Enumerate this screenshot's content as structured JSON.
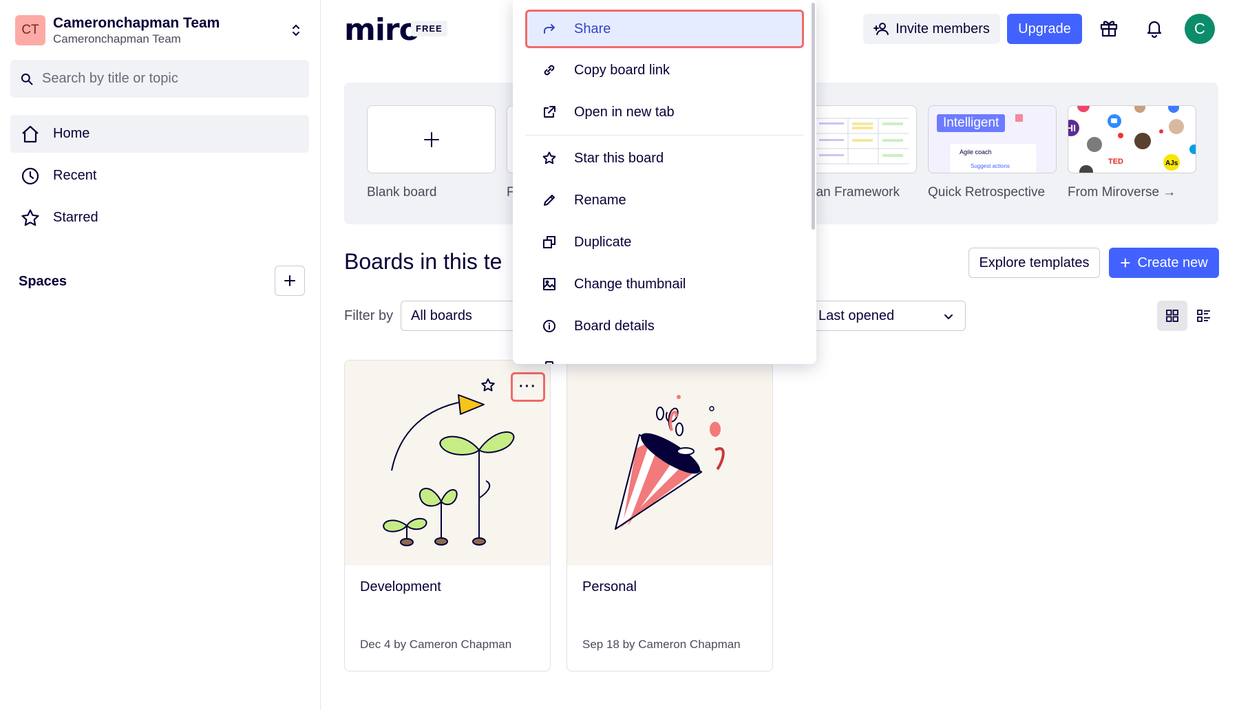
{
  "team": {
    "initials": "CT",
    "name": "Cameronchapman Team",
    "subtitle": "Cameronchapman Team"
  },
  "search": {
    "placeholder": "Search by title or topic"
  },
  "nav": {
    "home": "Home",
    "recent": "Recent",
    "starred": "Starred"
  },
  "spaces": {
    "label": "Spaces"
  },
  "header": {
    "logo": "miro",
    "plan": "FREE",
    "invite": "Invite members",
    "upgrade": "Upgrade",
    "avatar_initial": "C"
  },
  "templates": {
    "blank": "Blank board",
    "partial_left": "F",
    "partial_kanban": "oan Framework",
    "quick_retro": "Quick Retrospective",
    "miroverse": "From Miroverse →",
    "retro_tag": "Intelligent",
    "retro_coach": "Agile coach",
    "retro_actions": "Suggest actions",
    "ted": "TED",
    "ajs": "AJs",
    "hi": "HI"
  },
  "boards_section": {
    "title": "Boards in this te",
    "explore": "Explore templates",
    "create": "Create new",
    "filter_label": "Filter by",
    "filter_value": "All boards",
    "sort_value": "Last opened"
  },
  "boards": [
    {
      "name": "Development",
      "meta": "Dec 4 by Cameron Chapman",
      "more": "···"
    },
    {
      "name": "Personal",
      "meta": "Sep 18 by Cameron Chapman"
    }
  ],
  "menu": {
    "share": "Share",
    "copy_link": "Copy board link",
    "open_tab": "Open in new tab",
    "star": "Star this board",
    "rename": "Rename",
    "duplicate": "Duplicate",
    "thumbnail": "Change thumbnail",
    "details": "Board details"
  },
  "colors": {
    "accent": "#4262ff",
    "highlight_border": "#f06a6a",
    "selected_bg": "#e6ecff",
    "team_avatar": "#fdaaa6",
    "user_avatar": "#0c8c6b"
  }
}
